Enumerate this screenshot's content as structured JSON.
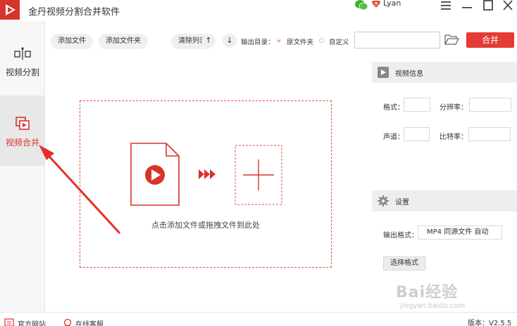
{
  "app": {
    "title": "金丹视频分割合并软件",
    "user_name": "Lyan",
    "accent": "#e43b34"
  },
  "window": {
    "menu_icon": "hamburger-icon",
    "minimize_icon": "minimize-icon",
    "maximize_icon": "maximize-icon",
    "close_icon": "close-icon"
  },
  "sidebar": {
    "items": [
      {
        "label": "视频分割",
        "icon": "split-icon",
        "active": false
      },
      {
        "label": "视频合并",
        "icon": "merge-icon",
        "active": true
      }
    ]
  },
  "toolbar": {
    "add_file": "添加文件",
    "add_folder": "添加文件夹",
    "clear_list": "清除列表",
    "move_up_icon": "arrow-up-icon",
    "move_down_icon": "arrow-down-icon",
    "output_label": "输出目录：",
    "option_source": "原文件夹",
    "option_custom": "自定义",
    "path_value": "",
    "merge_label": "合并"
  },
  "dropzone": {
    "hint": "点击添加文件或拖拽文件到此处"
  },
  "video_info": {
    "title": "视频信息",
    "format_label": "格式：",
    "format_value": "",
    "resolution_label": "分辨率：",
    "resolution_value": "",
    "channel_label": "声道：",
    "channel_value": "",
    "bitrate_label": "比特率：",
    "bitrate_value": ""
  },
  "settings": {
    "title": "设置",
    "output_format_label": "输出格式：",
    "output_format_value": "MP4 同源文件 自动",
    "choose_format": "选择格式"
  },
  "statusbar": {
    "website": "官方网站",
    "support": "在线客服",
    "version": "版本：V2.5.5"
  },
  "watermark": {
    "brand": "Bai经验",
    "url": "jingyan.baidu.com"
  }
}
